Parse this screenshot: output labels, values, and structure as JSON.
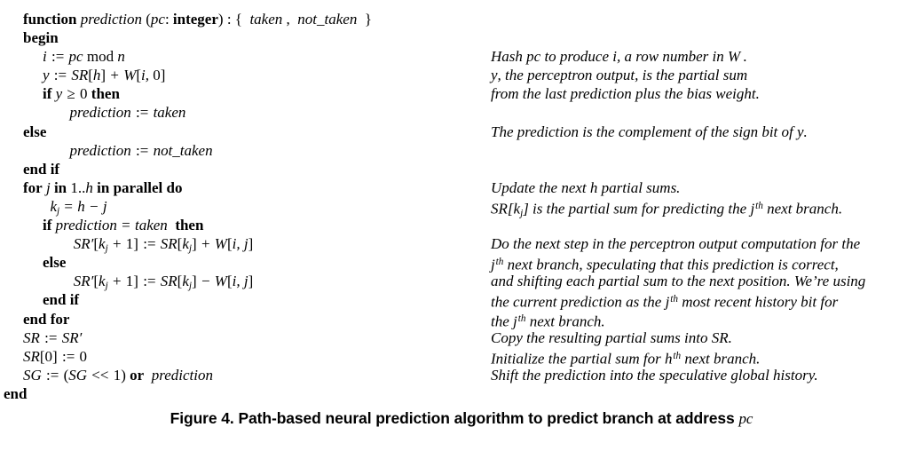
{
  "figure": {
    "caption_prefix": "Figure 4. Path-based neural prediction algorithm to predict branch at address",
    "caption_math": "pc"
  },
  "algorithm": {
    "code_lines": [
      {
        "id": "signature",
        "indent": 0,
        "text": "function prediction (pc: integer) : { taken , not_taken }"
      },
      {
        "id": "begin",
        "indent": 0,
        "text": "begin"
      },
      {
        "id": "hash-index",
        "indent": 1,
        "text": "i := pc mod n"
      },
      {
        "id": "compute-y",
        "indent": 1,
        "text": "y := SR[h] + W[i, 0]"
      },
      {
        "id": "if-y-ge-0",
        "indent": 1,
        "text": "if y >= 0 then"
      },
      {
        "id": "predict-taken",
        "indent": 2,
        "text": "prediction := taken"
      },
      {
        "id": "else-1",
        "indent": 1,
        "text": "else"
      },
      {
        "id": "predict-not-taken",
        "indent": 2,
        "text": "prediction := not_taken"
      },
      {
        "id": "end-if-1",
        "indent": 1,
        "text": "end if"
      },
      {
        "id": "for-j",
        "indent": 1,
        "text": "for j in 1..h in parallel do"
      },
      {
        "id": "kj-assign",
        "indent": 2,
        "text": "kj = h - j"
      },
      {
        "id": "if-prediction",
        "indent": 2,
        "text": "if prediction = taken  then"
      },
      {
        "id": "sr-plus",
        "indent": 3,
        "text": "SR'[kj + 1] := SR[kj] + W[i, j]"
      },
      {
        "id": "else-2",
        "indent": 2,
        "text": "else"
      },
      {
        "id": "sr-minus",
        "indent": 3,
        "text": "SR'[kj + 1] := SR[kj] - W[i, j]"
      },
      {
        "id": "end-if-2",
        "indent": 2,
        "text": "end if"
      },
      {
        "id": "end-for",
        "indent": 1,
        "text": "end for"
      },
      {
        "id": "sr-copy",
        "indent": 1,
        "text": "SR := SR'"
      },
      {
        "id": "sr-zero",
        "indent": 1,
        "text": "SR[0] := 0"
      },
      {
        "id": "sg-shift",
        "indent": 1,
        "text": "SG := (SG << 1) or prediction"
      },
      {
        "id": "end",
        "indent": 0,
        "text": "end"
      }
    ],
    "comment_lines": [
      {
        "id": "c-blank-1",
        "text": ""
      },
      {
        "id": "c-blank-2",
        "text": ""
      },
      {
        "id": "c-hash",
        "text": "Hash pc to produce i, a row number in W."
      },
      {
        "id": "c-y-1",
        "text": "y, the perceptron output, is the partial sum"
      },
      {
        "id": "c-y-2",
        "text": "from the last prediction plus the bias weight."
      },
      {
        "id": "c-blank-3",
        "text": ""
      },
      {
        "id": "c-complement",
        "text": "The prediction is the complement of the sign bit of y."
      },
      {
        "id": "c-blank-4",
        "text": ""
      },
      {
        "id": "c-blank-5",
        "text": ""
      },
      {
        "id": "c-update",
        "text": "Update the next h partial sums."
      },
      {
        "id": "c-srkj",
        "text": "SR[kj] is the partial sum for predicting the jth next branch."
      },
      {
        "id": "c-blank-6",
        "text": ""
      },
      {
        "id": "c-do-1",
        "text": "Do the next step in the perceptron output computation for the"
      },
      {
        "id": "c-do-2",
        "text": "jth next branch, speculating that this prediction is correct,"
      },
      {
        "id": "c-do-3",
        "text": "and shifting each partial sum to the next position. We're using"
      },
      {
        "id": "c-do-4",
        "text": "the current prediction as the jth most recent history bit for"
      },
      {
        "id": "c-do-5",
        "text": "the jth next branch."
      },
      {
        "id": "c-copy",
        "text": "Copy the resulting partial sums into SR."
      },
      {
        "id": "c-init",
        "text": "Initialize the partial sum for hth next branch."
      },
      {
        "id": "c-shift",
        "text": "Shift the prediction into the speculative global history."
      },
      {
        "id": "c-blank-7",
        "text": ""
      }
    ]
  },
  "colors": {
    "background": "#ffffff",
    "text": "#000000"
  }
}
